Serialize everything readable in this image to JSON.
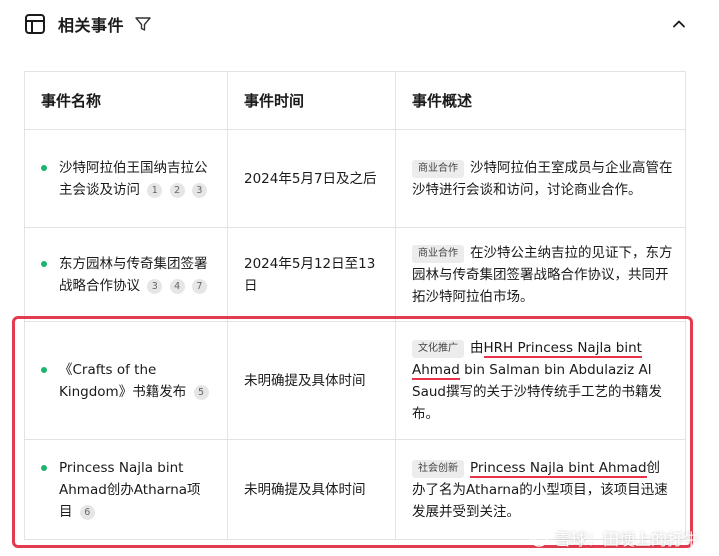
{
  "header": {
    "title": "相关事件"
  },
  "table": {
    "columns": [
      "事件名称",
      "事件时间",
      "事件概述"
    ],
    "rows": [
      {
        "name": "沙特阿拉伯王国纳吉拉公主会谈及访问",
        "refs": [
          "1",
          "2",
          "3"
        ],
        "time": "2024年5月7日及之后",
        "tag": "商业合作",
        "summary": "沙特阿拉伯王室成员与企业高管在沙特进行会谈和访问，讨论商业合作。"
      },
      {
        "name": "东方园林与传奇集团签署战略合作协议",
        "refs": [
          "3",
          "4",
          "7"
        ],
        "time": "2024年5月12日至13日",
        "tag": "商业合作",
        "summary": "在沙特公主纳吉拉的见证下，东方园林与传奇集团签署战略合作协议，共同开拓沙特阿拉伯市场。"
      },
      {
        "name": "《Crafts of the Kingdom》书籍发布",
        "refs": [
          "5"
        ],
        "time": "未明确提及具体时间",
        "tag": "文化推广",
        "summary_pre": "由",
        "summary_ul": "HRH Princess Najla bint Ahmad",
        "summary_post": " bin Salman bin Abdulaziz Al Saud撰写的关于沙特传统手工艺的书籍发布。"
      },
      {
        "name": "Princess Najla bint Ahmad创办Atharna项目",
        "refs": [
          "6"
        ],
        "time": "未明确提及具体时间",
        "tag": "社会创新",
        "summary_ul": "Princess Najla bint Ahmad",
        "summary_post": "创办了名为Atharna的小型项目，该项目迅速发展并受到关注。"
      }
    ]
  },
  "watermark": "雪球：田埂上的打牛",
  "colors": {
    "dot": "#1db56d",
    "highlight": "#e23c4e",
    "underline": "#e8344a"
  }
}
